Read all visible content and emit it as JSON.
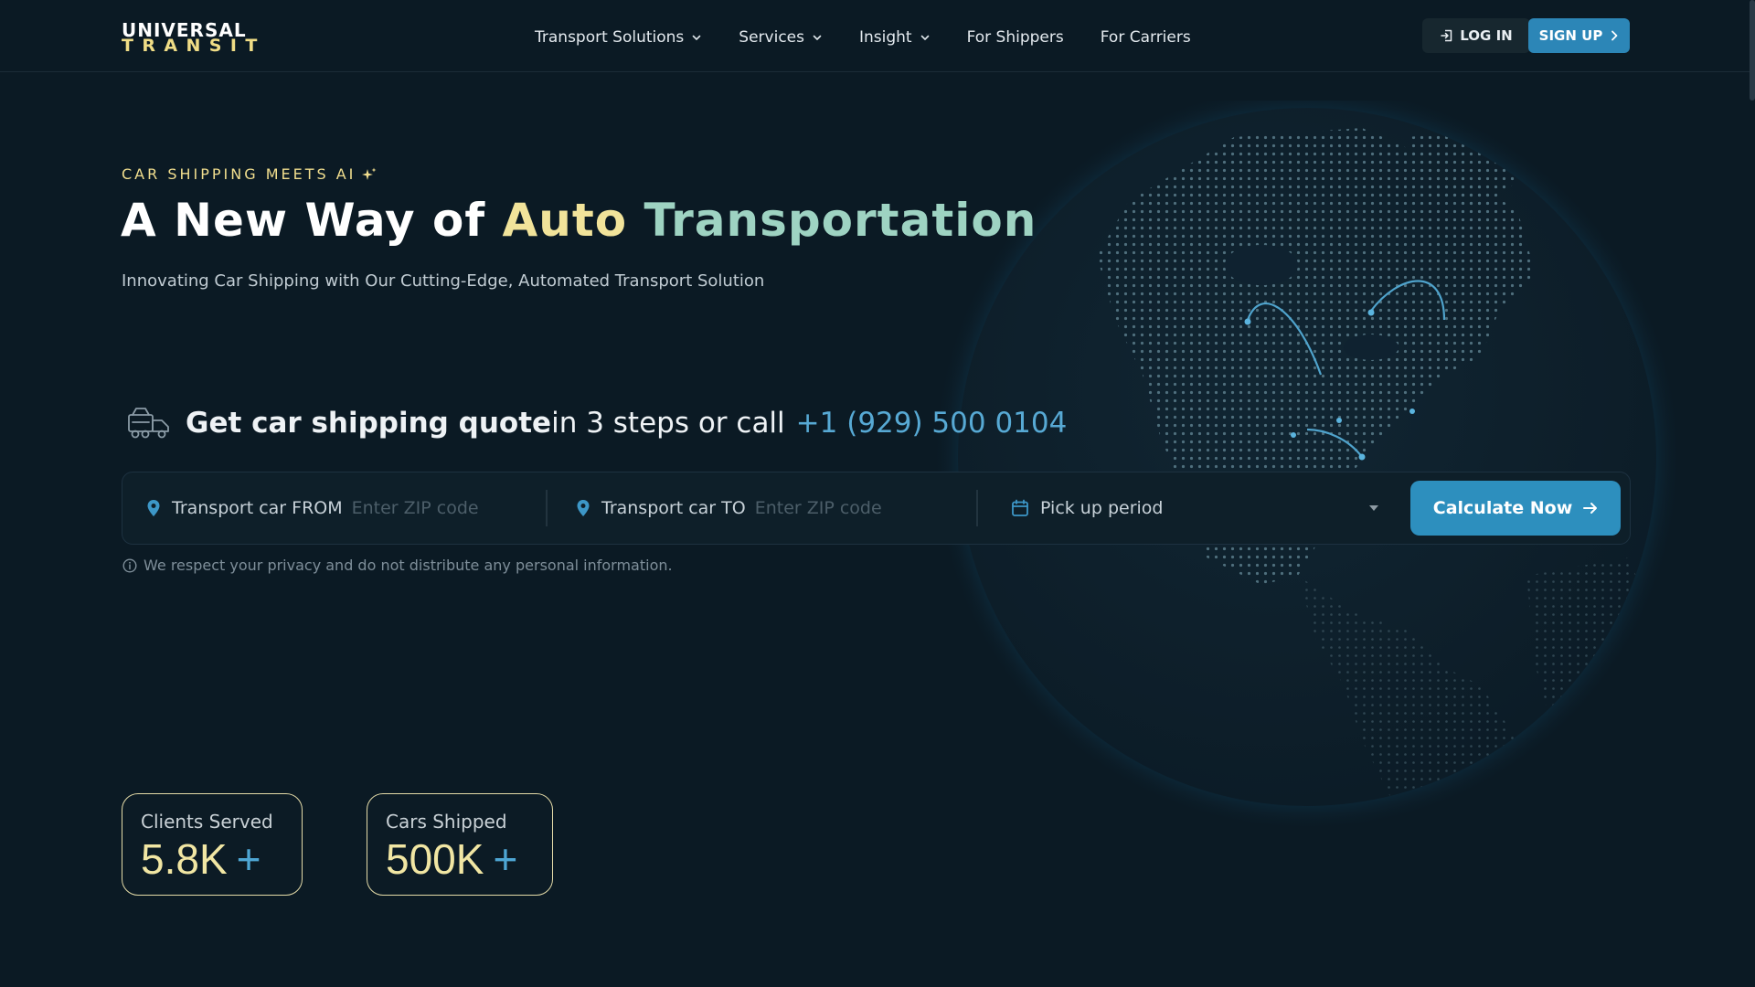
{
  "brand": {
    "line1": "UNIVERSAL",
    "line2": "TRANSIT"
  },
  "nav": {
    "items": [
      {
        "label": "Transport Solutions",
        "dropdown": true
      },
      {
        "label": "Services",
        "dropdown": true
      },
      {
        "label": "Insight",
        "dropdown": true
      },
      {
        "label": "For Shippers",
        "dropdown": false
      },
      {
        "label": "For Carriers",
        "dropdown": false
      }
    ],
    "login_label": "LOG IN",
    "signup_label": "SIGN UP"
  },
  "hero": {
    "eyebrow": "CAR SHIPPING MEETS AI",
    "title_part1": "A New Way of ",
    "title_part2": "Auto",
    "title_part3": "Transportation",
    "subtitle": "Innovating Car Shipping with Our Cutting-Edge, Automated Transport Solution"
  },
  "quote": {
    "strong": "Get car shipping quote",
    "rest": " in 3 steps or call",
    "phone": "+1 (929) 500 0104"
  },
  "form": {
    "from_label": "Transport car FROM",
    "from_placeholder": "Enter ZIP code",
    "to_label": "Transport car TO",
    "to_placeholder": "Enter ZIP code",
    "period_label": "Pick up period",
    "submit_label": "Calculate Now"
  },
  "privacy_note": "We respect your privacy and do not distribute any personal information.",
  "stats": [
    {
      "label": "Clients Served",
      "value": "5.8K",
      "suffix": "+"
    },
    {
      "label": "Cars Shipped",
      "value": "500K",
      "suffix": "+"
    }
  ],
  "colors": {
    "background": "#0b1a24",
    "accent_blue": "#2c86b7",
    "accent_yellow": "#f1e39a",
    "accent_teal": "#9ed3c2"
  },
  "icons": [
    "chevron-down-icon",
    "login-icon",
    "chevron-right-icon",
    "sparkle-icon",
    "car-carrier-truck-icon",
    "location-pin-icon",
    "calendar-icon",
    "caret-down-icon",
    "arrow-right-icon",
    "info-icon",
    "globe-graphic"
  ]
}
